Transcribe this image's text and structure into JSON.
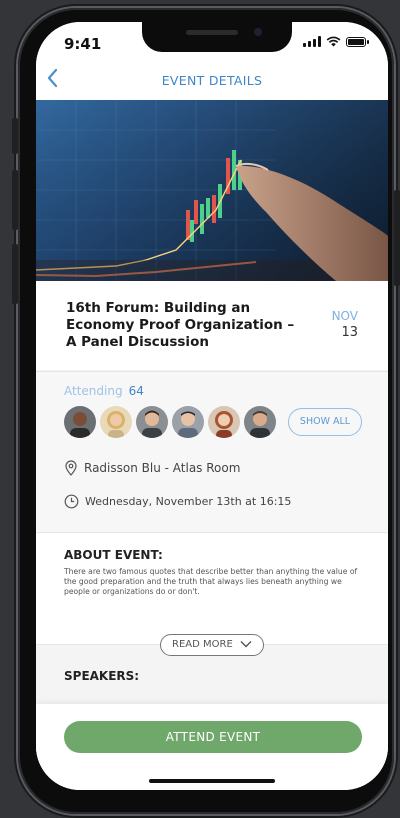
{
  "status": {
    "time": "9:41"
  },
  "nav": {
    "title": "EVENT DETAILS"
  },
  "event": {
    "title": "16th Forum: Building an Economy Proof Organization – A Panel Discussion",
    "month": "NOV",
    "day": "13"
  },
  "attending": {
    "label": "Attending",
    "count": "64",
    "show_all_label": "SHOW ALL"
  },
  "location": "Radisson Blu - Atlas Room",
  "datetime": "Wednesday, November 13th at 16:15",
  "about": {
    "heading": "ABOUT EVENT:",
    "body": "There are two famous quotes that describe better than anything the value of the good preparation and the truth that always lies beneath anything we people or organizations do or don't.",
    "read_more_label": "READ MORE"
  },
  "speakers": {
    "heading": "SPEAKERS:"
  },
  "cta": {
    "label": "ATTEND EVENT"
  },
  "colors": {
    "accent": "#3f86c9",
    "cta": "#6fa86a"
  },
  "icons": [
    "back-chevron-icon",
    "signal-icon",
    "wifi-icon",
    "battery-icon",
    "location-pin-icon",
    "clock-icon",
    "chevron-down-icon"
  ]
}
